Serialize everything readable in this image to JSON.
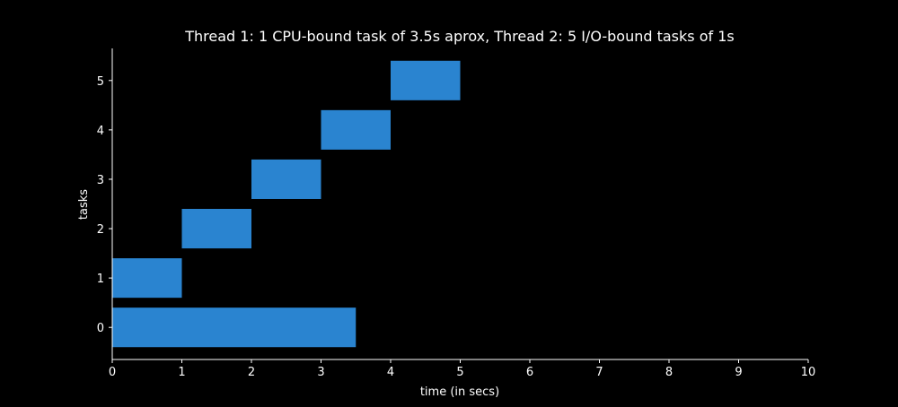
{
  "chart_data": {
    "type": "bar",
    "orientation": "horizontal-range",
    "title": "Thread 1: 1 CPU-bound task of 3.5s aprox, Thread 2: 5 I/O-bound tasks of 1s",
    "xlabel": "time (in secs)",
    "ylabel": "tasks",
    "xlim": [
      0,
      10
    ],
    "ylim": [
      -0.65,
      5.65
    ],
    "x_ticks": [
      "0",
      "1",
      "2",
      "3",
      "4",
      "5",
      "6",
      "7",
      "8",
      "9",
      "10"
    ],
    "y_ticks": [
      "0",
      "1",
      "2",
      "3",
      "4",
      "5"
    ],
    "bar_height": 0.8,
    "grid": false,
    "colors": {
      "background": "#000000",
      "bar": "#2a84d0",
      "axis": "#ffffff",
      "text": "#ffffff"
    },
    "bars": [
      {
        "task": 0,
        "start": 0,
        "end": 3.5
      },
      {
        "task": 1,
        "start": 0,
        "end": 1
      },
      {
        "task": 2,
        "start": 1,
        "end": 2
      },
      {
        "task": 3,
        "start": 2,
        "end": 3
      },
      {
        "task": 4,
        "start": 3,
        "end": 4
      },
      {
        "task": 5,
        "start": 4,
        "end": 5
      }
    ]
  }
}
